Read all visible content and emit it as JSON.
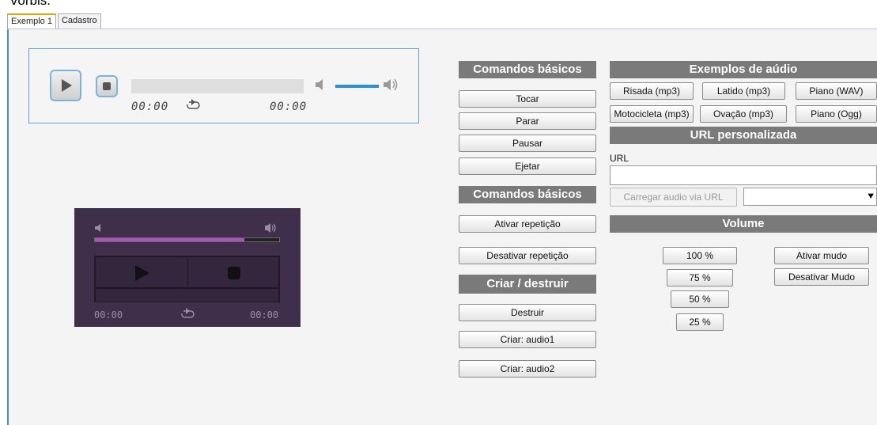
{
  "header": {
    "title_fragment": "Vorbis."
  },
  "tabs": [
    {
      "label": "Exemplo 1",
      "active": true
    },
    {
      "label": "Cadastro",
      "active": false
    }
  ],
  "player_light": {
    "time_current": "00:00",
    "time_total": "00:00",
    "volume_level": 0.7,
    "accent_color": "#2a8fd8"
  },
  "player_dark": {
    "time_current": "00:00",
    "time_total": "00:00",
    "progress": 0.81,
    "accent_color": "#b04fc0"
  },
  "basic_commands": {
    "title": "Comandos básicos",
    "buttons": [
      "Tocar",
      "Parar",
      "Pausar",
      "Ejetar"
    ]
  },
  "basic_commands_2": {
    "title": "Comandos básicos",
    "buttons": [
      "Ativar repetição",
      "Desativar repetição"
    ]
  },
  "create_destroy": {
    "title": "Criar / destruir",
    "buttons": [
      "Destruir",
      "Criar: audio1",
      "Criar: audio2"
    ]
  },
  "audio_examples": {
    "title": "Exemplos de aúdio",
    "buttons": [
      "Risada (mp3)",
      "Latido (mp3)",
      "Piano (WAV)",
      "Motocicleta (mp3)",
      "Ovação (mp3)",
      "Piano (Ogg)"
    ]
  },
  "custom_url": {
    "title": "URL personalizada",
    "label": "URL",
    "value": "",
    "load_button": "Carregar audio via URL",
    "select_value": ""
  },
  "volume": {
    "title": "Volume",
    "levels": [
      "100 %",
      "75 %",
      "50 %",
      "25 %"
    ],
    "mute_on": "Ativar mudo",
    "mute_off": "Desativar Mudo"
  },
  "colors": {
    "header_bg": "#7a7a7a",
    "panel_border": "#4a8fc9",
    "active_tab": "#f0a000"
  }
}
